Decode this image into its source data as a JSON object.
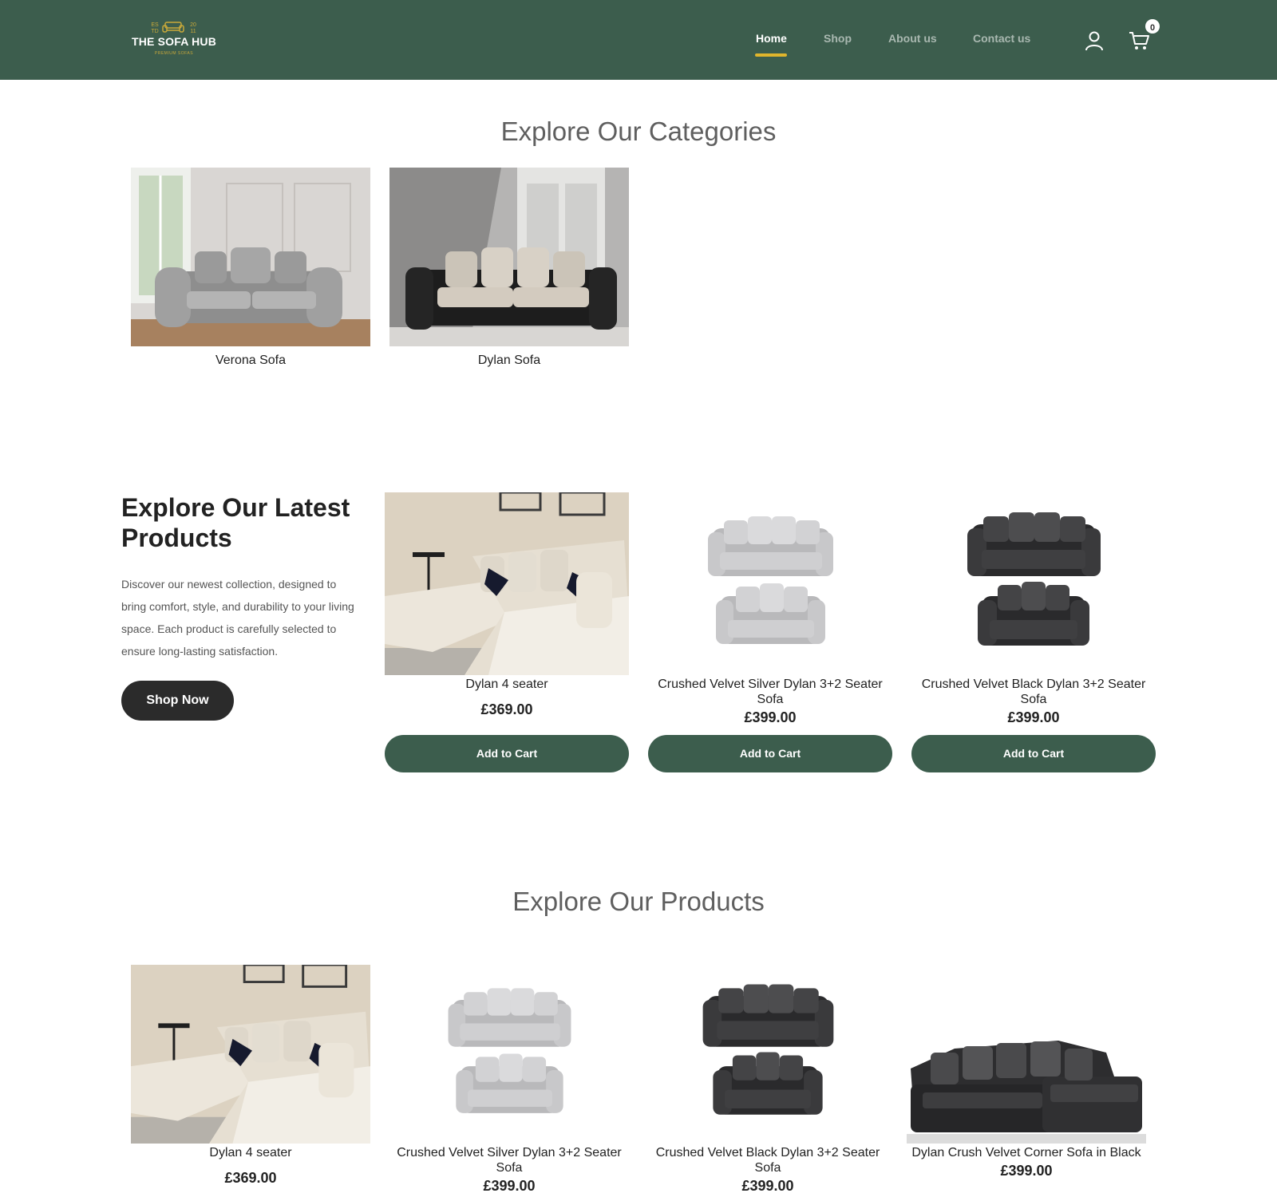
{
  "header": {
    "logo": {
      "est_left": "ES TD",
      "est_right": "20 11",
      "title": "THE SOFA HUB",
      "subtitle": "PREMIUM SOFAS"
    },
    "nav": [
      {
        "label": "Home",
        "active": true
      },
      {
        "label": "Shop",
        "active": false
      },
      {
        "label": "About us",
        "active": false
      },
      {
        "label": "Contact us",
        "active": false
      }
    ],
    "cart_count": "0",
    "colors": {
      "bar": "#3c5d4d",
      "accent": "#e0b52c"
    }
  },
  "categories": {
    "title": "Explore Our Categories",
    "items": [
      {
        "label": "Verona Sofa"
      },
      {
        "label": "Dylan Sofa"
      }
    ]
  },
  "latest": {
    "title": "Explore Our Latest Products",
    "description": "Discover our newest collection, designed to bring comfort, style, and durability to your living space. Each product is carefully selected to ensure long-lasting satisfaction.",
    "cta": "Shop Now",
    "products": [
      {
        "name": "Dylan 4 seater",
        "price": "£369.00",
        "button": "Add to Cart"
      },
      {
        "name": "Crushed Velvet Silver Dylan 3+2 Seater Sofa",
        "price": "£399.00",
        "button": "Add to Cart"
      },
      {
        "name": "Crushed Velvet Black Dylan 3+2 Seater Sofa",
        "price": "£399.00",
        "button": "Add to Cart"
      }
    ]
  },
  "products": {
    "title": "Explore Our Products",
    "items": [
      {
        "name": "Dylan 4 seater",
        "price": "£369.00"
      },
      {
        "name": "Crushed Velvet Silver Dylan 3+2 Seater Sofa",
        "price": "£399.00"
      },
      {
        "name": "Crushed Velvet Black Dylan 3+2 Seater Sofa",
        "price": "£399.00"
      },
      {
        "name": "Dylan Crush Velvet Corner Sofa in Black",
        "price": "£399.00"
      }
    ]
  }
}
